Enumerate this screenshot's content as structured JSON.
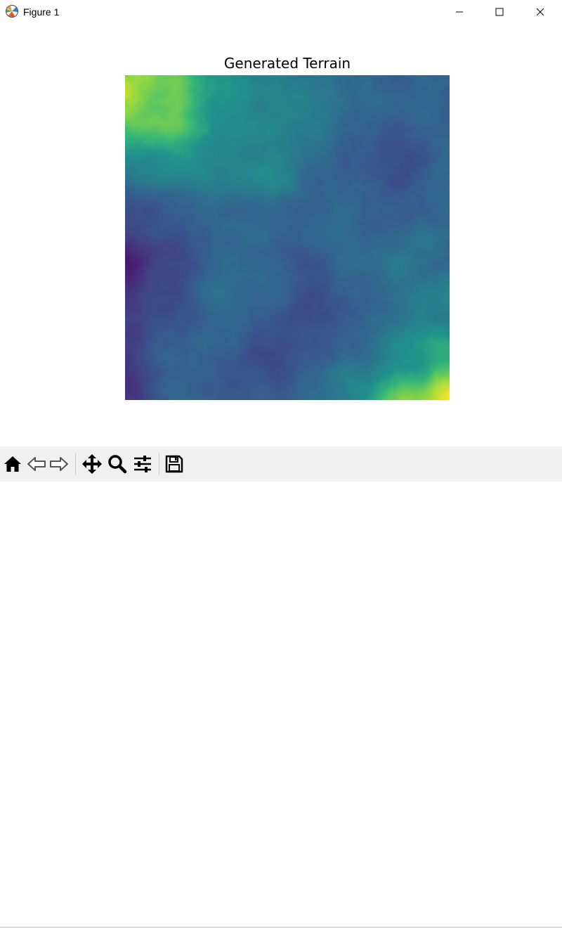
{
  "window": {
    "title": "Figure 1",
    "controls": [
      "minimize",
      "maximize",
      "close"
    ]
  },
  "figure": {
    "title": "Generated Terrain"
  },
  "toolbar": {
    "tools": [
      {
        "name": "home",
        "icon": "home-icon"
      },
      {
        "name": "back",
        "icon": "arrow-left-icon"
      },
      {
        "name": "forward",
        "icon": "arrow-right-icon"
      },
      {
        "name": "pan",
        "icon": "move-arrows-icon"
      },
      {
        "name": "zoom",
        "icon": "magnifier-icon"
      },
      {
        "name": "configure-subplots",
        "icon": "sliders-icon"
      },
      {
        "name": "save",
        "icon": "floppy-disk-icon"
      }
    ]
  },
  "chart_data": {
    "type": "heatmap",
    "title": "Generated Terrain",
    "colormap": "viridis",
    "axes_visible": false,
    "grid_rows": 8,
    "grid_cols": 8,
    "values": [
      [
        0.95,
        0.8,
        0.62,
        0.55,
        0.5,
        0.45,
        0.4,
        0.42
      ],
      [
        0.85,
        0.82,
        0.6,
        0.55,
        0.5,
        0.38,
        0.38,
        0.4
      ],
      [
        0.55,
        0.6,
        0.58,
        0.6,
        0.45,
        0.35,
        0.3,
        0.4
      ],
      [
        0.3,
        0.35,
        0.45,
        0.45,
        0.42,
        0.4,
        0.4,
        0.45
      ],
      [
        0.12,
        0.25,
        0.4,
        0.38,
        0.35,
        0.42,
        0.48,
        0.45
      ],
      [
        0.25,
        0.3,
        0.45,
        0.4,
        0.3,
        0.38,
        0.5,
        0.55
      ],
      [
        0.25,
        0.4,
        0.35,
        0.3,
        0.38,
        0.45,
        0.6,
        0.7
      ],
      [
        0.2,
        0.4,
        0.35,
        0.35,
        0.45,
        0.6,
        0.85,
        0.95
      ]
    ]
  }
}
